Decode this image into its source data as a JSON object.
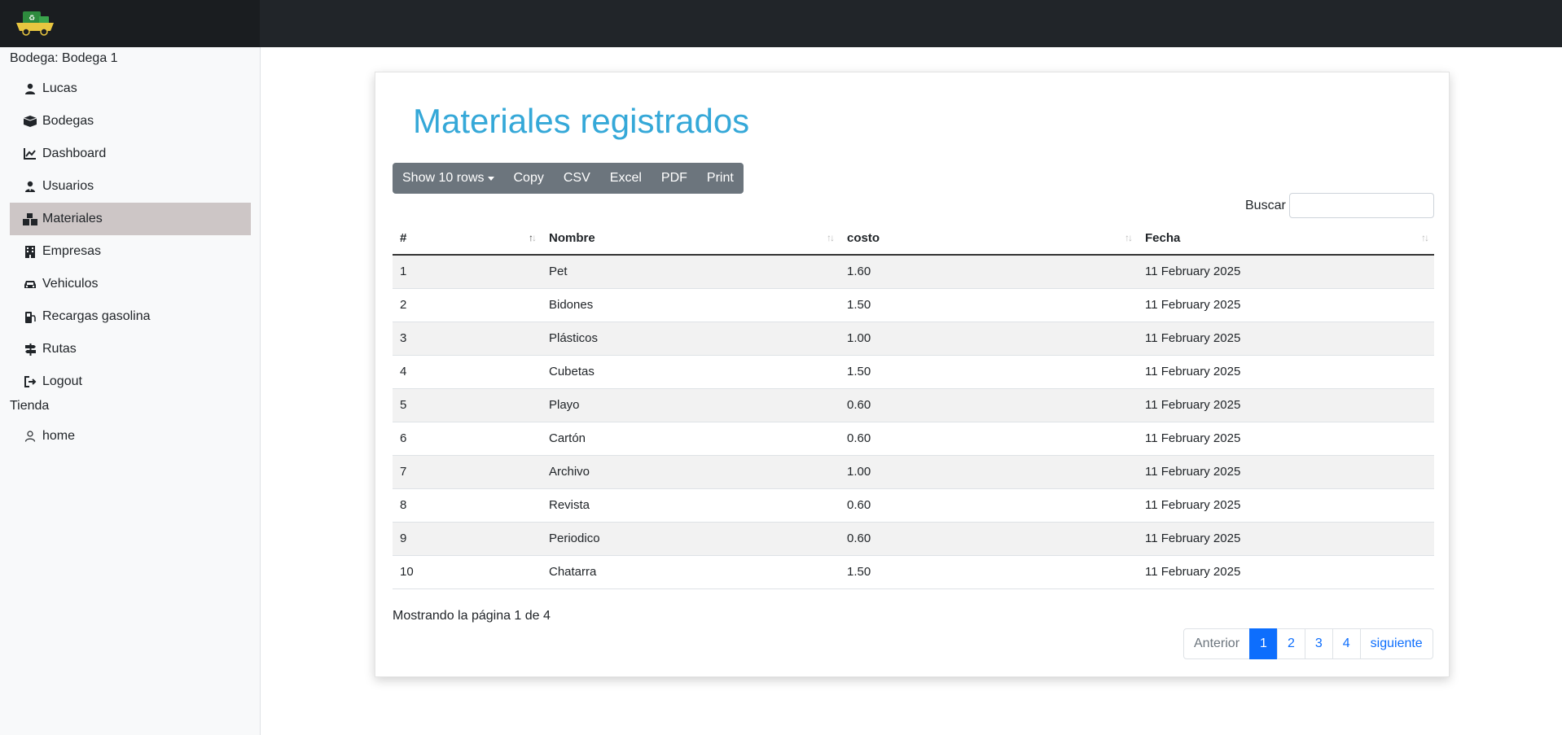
{
  "sidebar": {
    "section1": "Bodega: Bodega 1",
    "items": [
      {
        "label": "Lucas"
      },
      {
        "label": "Bodegas"
      },
      {
        "label": "Dashboard"
      },
      {
        "label": "Usuarios"
      },
      {
        "label": "Materiales"
      },
      {
        "label": "Empresas"
      },
      {
        "label": "Vehiculos"
      },
      {
        "label": "Recargas gasolina"
      },
      {
        "label": "Rutas"
      },
      {
        "label": "Logout"
      }
    ],
    "section2": "Tienda",
    "items2": [
      {
        "label": "home"
      }
    ]
  },
  "main": {
    "title": "Materiales registrados",
    "buttons": {
      "show_rows": "Show 10 rows",
      "copy": "Copy",
      "csv": "CSV",
      "excel": "Excel",
      "pdf": "PDF",
      "print": "Print"
    },
    "search_label": "Buscar",
    "columns": [
      "#",
      "Nombre",
      "costo",
      "Fecha"
    ],
    "rows": [
      [
        "1",
        "Pet",
        "1.60",
        "11 February 2025"
      ],
      [
        "2",
        "Bidones",
        "1.50",
        "11 February 2025"
      ],
      [
        "3",
        "Plásticos",
        "1.00",
        "11 February 2025"
      ],
      [
        "4",
        "Cubetas",
        "1.50",
        "11 February 2025"
      ],
      [
        "5",
        "Playo",
        "0.60",
        "11 February 2025"
      ],
      [
        "6",
        "Cartón",
        "0.60",
        "11 February 2025"
      ],
      [
        "7",
        "Archivo",
        "1.00",
        "11 February 2025"
      ],
      [
        "8",
        "Revista",
        "0.60",
        "11 February 2025"
      ],
      [
        "9",
        "Periodico",
        "0.60",
        "11 February 2025"
      ],
      [
        "10",
        "Chatarra",
        "1.50",
        "11 February 2025"
      ]
    ],
    "info": "Mostrando la página 1 de 4",
    "pagination": {
      "prev": "Anterior",
      "pages": [
        "1",
        "2",
        "3",
        "4"
      ],
      "next": "siguiente"
    }
  },
  "colors": {
    "title": "#35a8d8",
    "active_nav": "#cdc6c6",
    "button_group": "#6c757d",
    "active_page": "#0d6efd"
  }
}
